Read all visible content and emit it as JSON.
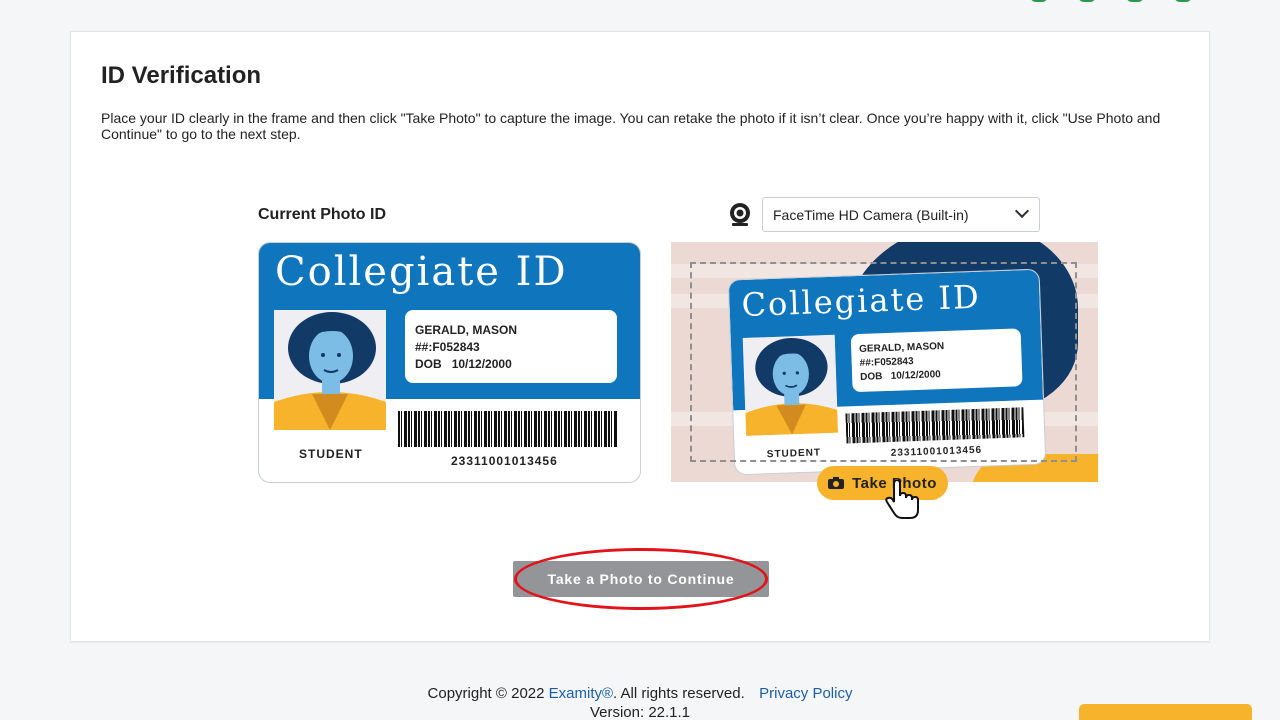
{
  "page": {
    "title": "ID Verification",
    "description": "Place your ID clearly in the frame and then click \"Take Photo\" to capture the image. You can retake the photo if it isn’t clear. Once you’re happy with it, click \"Use Photo and Continue\" to go to the next step."
  },
  "current_id": {
    "label": "Current Photo ID",
    "card_title": "Collegiate ID",
    "name": "GERALD, MASON",
    "id_number": "##:F052843",
    "dob_label": "DOB",
    "dob": "10/12/2000",
    "role": "STUDENT",
    "barcode_number": "23311001013456"
  },
  "camera": {
    "selected": "FaceTime HD Camera (Built-in)",
    "take_photo_label": "Take Photo"
  },
  "continue_button": {
    "label": "Take a Photo to Continue"
  },
  "footer": {
    "copyright": "Copyright © 2022",
    "brand_link": "Examity®",
    "rights": ".  All rights reserved.",
    "privacy_link": "Privacy Policy",
    "version": "Version: 22.1.1"
  },
  "colors": {
    "card_blue": "#0f75bc",
    "accent_yellow": "#f7b32b",
    "disabled_gray": "#939598",
    "annotation_red": "#e3131b",
    "link_blue": "#1a5fa8"
  }
}
